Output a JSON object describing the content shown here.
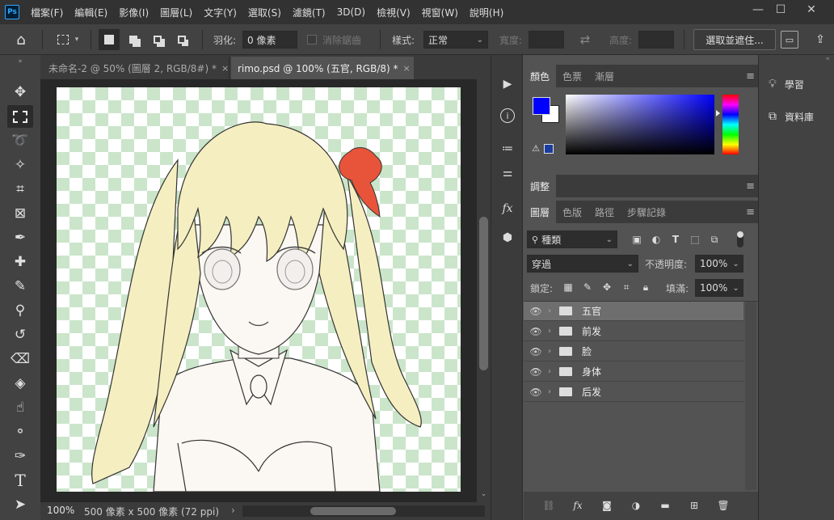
{
  "app": {
    "logo": "Ps"
  },
  "menus": [
    "檔案(F)",
    "編輯(E)",
    "影像(I)",
    "圖層(L)",
    "文字(Y)",
    "選取(S)",
    "濾鏡(T)",
    "3D(D)",
    "檢視(V)",
    "視窗(W)",
    "說明(H)"
  ],
  "window": {
    "minimize": "—",
    "restore": "☐",
    "close": "✕"
  },
  "options": {
    "feather_label": "羽化:",
    "feather_value": "0 像素",
    "antialias_label": "消除鋸齒",
    "style_label": "樣式:",
    "style_value": "正常",
    "width_label": "寬度:",
    "height_label": "高度:",
    "select_mask_label": "選取並遮住..."
  },
  "tabs": [
    {
      "label": "未命名-2 @ 50% (圖層 2, RGB/8#) *",
      "close": "×",
      "active": false
    },
    {
      "label": "rimo.psd @ 100% (五官, RGB/8) *",
      "close": "×",
      "active": true
    }
  ],
  "status": {
    "zoom": "100%",
    "doc_info": "500 像素 x 500 像素 (72 ppi)",
    "arrow": "›"
  },
  "color_panel": {
    "tabs": [
      "顏色",
      "色票",
      "漸層"
    ],
    "foreground": "#0000ff",
    "background": "#ffffff"
  },
  "adjust_panel": {
    "tabs": [
      "調整"
    ]
  },
  "layers_panel": {
    "tabs": [
      "圖層",
      "色版",
      "路徑",
      "步驟記錄"
    ],
    "filter_label": "種類",
    "blend_mode": "穿過",
    "opacity_label": "不透明度:",
    "opacity_value": "100%",
    "lock_label": "鎖定:",
    "fill_label": "填滿:",
    "fill_value": "100%",
    "layers": [
      {
        "name": "五官",
        "selected": true
      },
      {
        "name": "前发",
        "selected": false
      },
      {
        "name": "脸",
        "selected": false
      },
      {
        "name": "身体",
        "selected": false
      },
      {
        "name": "后发",
        "selected": false
      }
    ]
  },
  "right_dock": {
    "learn": "學習",
    "library": "資料庫"
  },
  "colors": {
    "accent_blue": "#31a8ff",
    "hair": "#f5eec0",
    "bow": "#e8543a",
    "skin": "#fbf7f2"
  }
}
